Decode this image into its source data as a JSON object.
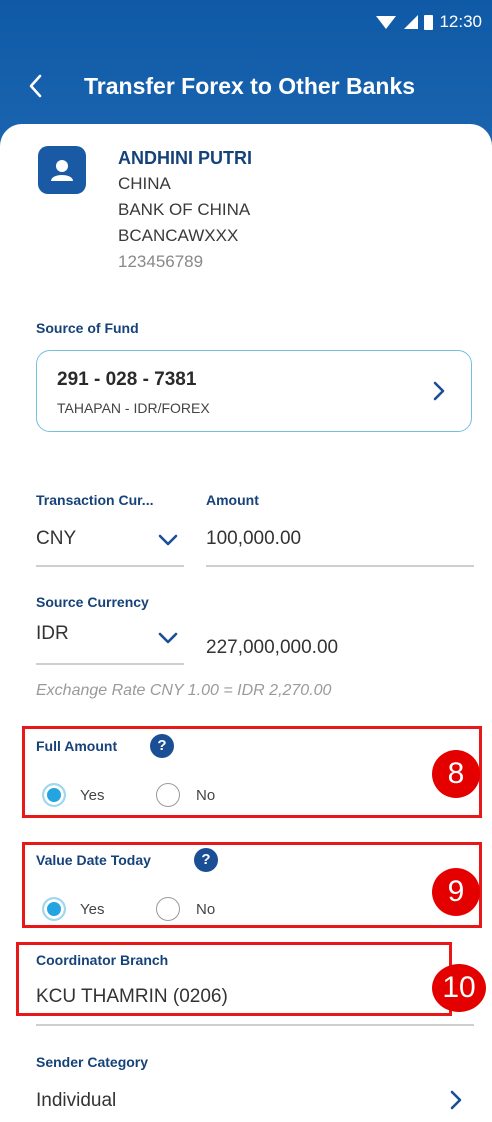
{
  "status_bar": {
    "time": "12:30"
  },
  "header": {
    "title": "Transfer Forex to Other Banks"
  },
  "recipient": {
    "name": "ANDHINI PUTRI",
    "country": "CHINA",
    "bank": "BANK OF CHINA",
    "swift": "BCANCAWXXX",
    "account": "123456789"
  },
  "source_of_fund": {
    "label": "Source of Fund",
    "account": "291 - 028 - 7381",
    "type": "TAHAPAN - IDR/FOREX"
  },
  "transaction_currency": {
    "label": "Transaction Cur...",
    "value": "CNY"
  },
  "amount": {
    "label": "Amount",
    "value": "100,000.00"
  },
  "source_currency": {
    "label": "Source Currency",
    "value": "IDR",
    "converted": "227,000,000.00"
  },
  "exchange_rate": "Exchange Rate CNY 1.00 = IDR 2,270.00",
  "full_amount": {
    "label": "Full Amount",
    "yes": "Yes",
    "no": "No",
    "selected": "Yes"
  },
  "value_date_today": {
    "label": "Value Date Today",
    "yes": "Yes",
    "no": "No",
    "selected": "Yes"
  },
  "coordinator_branch": {
    "label": "Coordinator Branch",
    "value": "KCU THAMRIN (0206)"
  },
  "sender_category": {
    "label": "Sender Category",
    "value": "Individual"
  },
  "annotations": [
    "8",
    "9",
    "10"
  ],
  "colors": {
    "header": "#1a5eaa",
    "accent": "#24a4e0",
    "label": "#16427a",
    "annotation": "#e50000"
  }
}
